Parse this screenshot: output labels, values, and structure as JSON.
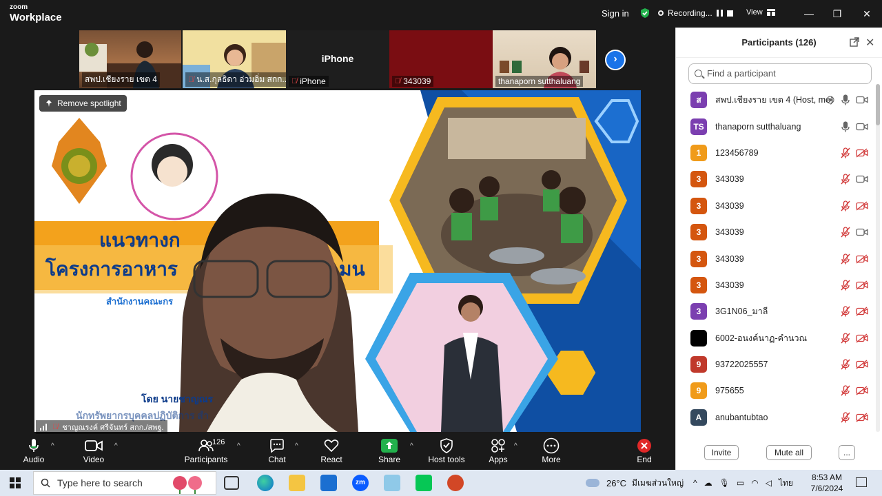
{
  "app": {
    "brand_small": "zoom",
    "brand_large": "Workplace"
  },
  "topbar": {
    "sign_in": "Sign in",
    "recording_label": "Recording...",
    "view_label": "View"
  },
  "thumbnails": [
    {
      "name": "สพป.เชียงราย เขต 4",
      "muted": false,
      "kind": "video"
    },
    {
      "name": "น.ส.กุลธิดา อ่วมอิ่ม สกก...",
      "muted": true,
      "kind": "video"
    },
    {
      "name": "iPhone",
      "title": "iPhone",
      "muted": true,
      "kind": "name"
    },
    {
      "name": "343039",
      "muted": true,
      "kind": "red"
    },
    {
      "name": "thanaporn sutthaluang",
      "muted": false,
      "kind": "video"
    }
  ],
  "main": {
    "remove_spotlight": "Remove spotlight",
    "speaker_name": "ชาญณรงค์ ศรีจันทร์ สกก./สพฐ.",
    "slide": {
      "title_line1": "แนวทางก",
      "title_line2": "โครงการอาหาร",
      "title_line2_end": "มน",
      "subtitle": "สำนักงานคณะกร",
      "byline": "โดย นายชาญณร",
      "byline2": "นักทรัพยากรบุคคลปฏิบัติการ สำ"
    }
  },
  "toolbar": {
    "audio": "Audio",
    "video": "Video",
    "participants": "Participants",
    "participants_count": "126",
    "chat": "Chat",
    "react": "React",
    "share": "Share",
    "host_tools": "Host tools",
    "apps": "Apps",
    "more": "More",
    "end": "End"
  },
  "participants_panel": {
    "title": "Participants (126)",
    "search_placeholder": "Find a participant",
    "invite": "Invite",
    "mute_all": "Mute all",
    "more": "...",
    "list": [
      {
        "initial": "ส",
        "color": "#7b3fb0",
        "name": "สพป.เชียงราย เขต 4 (Host, me)",
        "mic": "on",
        "cam": "on",
        "rec": true
      },
      {
        "initial": "TS",
        "color": "#7b3fb0",
        "name": "thanaporn sutthaluang",
        "mic": "on",
        "cam": "on"
      },
      {
        "initial": "1",
        "color": "#f09b1a",
        "name": "123456789",
        "mic": "off",
        "cam": "off"
      },
      {
        "initial": "3",
        "color": "#d4560f",
        "name": "343039",
        "mic": "off",
        "cam": "on"
      },
      {
        "initial": "3",
        "color": "#d4560f",
        "name": "343039",
        "mic": "off",
        "cam": "off"
      },
      {
        "initial": "3",
        "color": "#d4560f",
        "name": "343039",
        "mic": "off",
        "cam": "on"
      },
      {
        "initial": "3",
        "color": "#d4560f",
        "name": "343039",
        "mic": "off",
        "cam": "off"
      },
      {
        "initial": "3",
        "color": "#d4560f",
        "name": "343039",
        "mic": "off",
        "cam": "off"
      },
      {
        "initial": "3",
        "color": "#7b3fb0",
        "name": "3G1N06_มาลี",
        "mic": "off",
        "cam": "off"
      },
      {
        "initial": "",
        "color": "#000000",
        "name": "6002-อนงค์นาฏ-คำนวณ",
        "mic": "off",
        "cam": "off"
      },
      {
        "initial": "9",
        "color": "#c0392b",
        "name": "93722025557",
        "mic": "off",
        "cam": "off"
      },
      {
        "initial": "9",
        "color": "#f09b1a",
        "name": "975655",
        "mic": "off",
        "cam": "off"
      },
      {
        "initial": "A",
        "color": "#34495e",
        "name": "anubantubtao",
        "mic": "off",
        "cam": "off"
      }
    ]
  },
  "taskbar": {
    "search_placeholder": "Type here to search",
    "weather": "26°C",
    "weather_desc": "มีเมฆส่วนใหญ่",
    "lang": "ไทย",
    "time": "8:53 AM",
    "date": "7/6/2024"
  },
  "colors": {
    "accent": "#1a73e8",
    "record_red": "#e04545",
    "share_green": "#22b14c",
    "end_red": "#e02828"
  }
}
